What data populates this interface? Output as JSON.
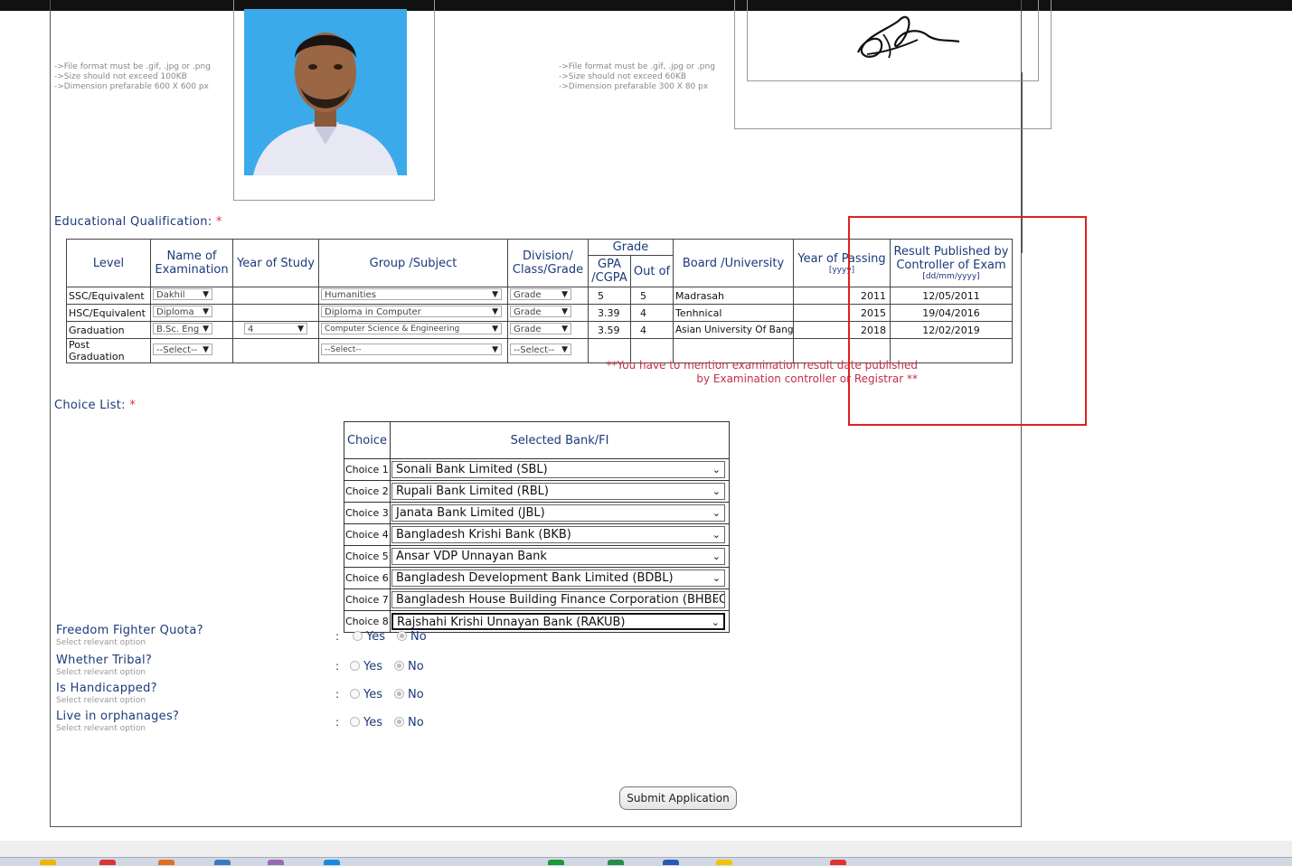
{
  "photo_notes": [
    "->File format must be .gif, .jpg or .png",
    "->Size should not exceed 100KB",
    "->Dimension prefarable 600 X 600 px"
  ],
  "signature_notes": [
    "->File format must be .gif, .jpg or .png",
    "->Size should not exceed 60KB",
    "->Dimension prefarable 300 X 80 px"
  ],
  "education": {
    "title": "Educational Qualification:",
    "required_mark": "*",
    "headers": {
      "level": "Level",
      "exam": "Name of Examination",
      "year_of_study": "Year of Study",
      "group": "Group /Subject",
      "division": "Division/ Class/Grade",
      "grade": "Grade",
      "gpa": "GPA /CGPA",
      "out_of": "Out of",
      "board": "Board /University",
      "year_passing": "Year of Passing",
      "year_passing_fmt": "[yyyy]",
      "result_published": "Result Published by Controller of Exam",
      "result_fmt": "[dd/mm/yyyy]"
    },
    "rows": [
      {
        "level": "SSC/Equivalent",
        "exam": "Dakhil",
        "study": "",
        "group": "Humanities",
        "division": "Grade",
        "gpa": "5",
        "out_of": "5",
        "board": "Madrasah",
        "year": "2011",
        "published": "12/05/2011"
      },
      {
        "level": "HSC/Equivalent",
        "exam": "Diploma",
        "study": "",
        "group": "Diploma in Computer",
        "division": "Grade",
        "gpa": "3.39",
        "out_of": "4",
        "board": "Tenhnical",
        "year": "2015",
        "published": "19/04/2016"
      },
      {
        "level": "Graduation",
        "exam": "B.Sc. Eng",
        "study": "4",
        "group": "Computer Science & Engineering",
        "division": "Grade",
        "gpa": "3.59",
        "out_of": "4",
        "board": "Asian University Of Bangl",
        "year": "2018",
        "published": "12/02/2019"
      },
      {
        "level": "Post Graduation",
        "exam": "--Select--",
        "study": "",
        "group": "--Select--",
        "division": "--Select--",
        "gpa": "",
        "out_of": "",
        "board": "",
        "year": "",
        "published": ""
      }
    ],
    "warning_line1": "**You have to mention examination result date published",
    "warning_line2": "by Examination controller or Registrar **"
  },
  "choice_list": {
    "title": "Choice List:",
    "required_mark": "*",
    "col_choice": "Choice",
    "col_bank": "Selected Bank/FI",
    "rows": [
      {
        "label": "Choice 1",
        "bank": "Sonali Bank Limited (SBL)"
      },
      {
        "label": "Choice 2",
        "bank": "Rupali Bank Limited (RBL)"
      },
      {
        "label": "Choice 3",
        "bank": "Janata Bank Limited (JBL)"
      },
      {
        "label": "Choice 4",
        "bank": "Bangladesh Krishi Bank (BKB)"
      },
      {
        "label": "Choice 5",
        "bank": "Ansar VDP Unnayan Bank"
      },
      {
        "label": "Choice 6",
        "bank": "Bangladesh Development Bank Limited (BDBL)"
      },
      {
        "label": "Choice 7",
        "bank": "Bangladesh House Building Finance Corporation (BHBFC)"
      },
      {
        "label": "Choice 8",
        "bank": "Rajshahi Krishi Unnayan Bank (RAKUB)"
      }
    ]
  },
  "questions": [
    {
      "label": "Freedom Fighter Quota?",
      "hint": "Select relevant option",
      "yes": "Yes",
      "no": "No",
      "selected": "No"
    },
    {
      "label": "Whether Tribal?",
      "hint": "Select relevant option",
      "yes": "Yes",
      "no": "No",
      "selected": "No"
    },
    {
      "label": "Is Handicapped?",
      "hint": "Select relevant option",
      "yes": "Yes",
      "no": "No",
      "selected": "No"
    },
    {
      "label": "Live in orphanages?",
      "hint": "Select relevant option",
      "yes": "Yes",
      "no": "No",
      "selected": "No"
    }
  ],
  "colon": ":",
  "submit_label": "Submit Application",
  "colors": {
    "highlight": "#e02020",
    "heading": "#1a3a7a",
    "warning": "#c0304a"
  }
}
